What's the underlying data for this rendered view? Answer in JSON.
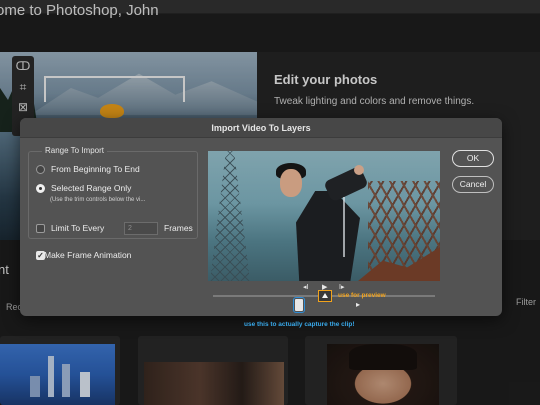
{
  "background": {
    "welcome": "ome to Photoshop, John",
    "edit_title": "Edit your photos",
    "edit_subtitle": "Tweak lighting and colors and remove things.",
    "section_fragment": "nt",
    "recent_fragment": "Rec",
    "filter_fragment": "Filter",
    "tools": [
      "lasso-icon",
      "crop-icon",
      "frame-icon"
    ]
  },
  "dialog": {
    "title": "Import Video To Layers",
    "range_group_label": "Range To Import",
    "option_from_beginning": "From Beginning To End",
    "option_selected_range": "Selected Range Only",
    "selected_range_hint": "(Use the trim controls below the vi...",
    "limit_label": "Limit To Every",
    "frames_value": "2",
    "frames_unit": "Frames",
    "make_frame_animation": "Make Frame Animation",
    "selected_option": "selected-range",
    "limit_checked": false,
    "frame_animation_checked": true,
    "ok_label": "OK",
    "cancel_label": "Cancel"
  },
  "player": {
    "prev_label": "◂I",
    "play_label": "▶",
    "next_label": "I▸"
  },
  "annotations": {
    "preview_note": "use for preview",
    "capture_note": "use this to actually capture the clip!",
    "preview_color": "#f2a31c",
    "capture_color": "#39a9ea"
  }
}
